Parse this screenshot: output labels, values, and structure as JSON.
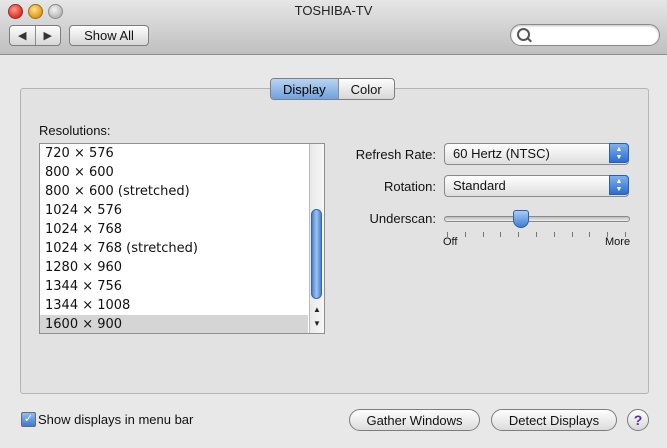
{
  "window": {
    "title": "TOSHIBA-TV"
  },
  "toolbar": {
    "back_glyph": "◀",
    "forward_glyph": "▶",
    "show_all_label": "Show All",
    "search_placeholder": ""
  },
  "tabs": [
    {
      "label": "Display",
      "selected": true
    },
    {
      "label": "Color",
      "selected": false
    }
  ],
  "resolutions": {
    "label": "Resolutions:",
    "items": [
      "720 × 576",
      "800 × 600",
      "800 × 600 (stretched)",
      "1024 × 576",
      "1024 × 768",
      "1024 × 768 (stretched)",
      "1280 × 960",
      "1344 × 756",
      "1344 × 1008",
      "1600 × 900"
    ],
    "selected_index": 9
  },
  "refresh_rate": {
    "label": "Refresh Rate:",
    "value": "60 Hertz (NTSC)"
  },
  "rotation": {
    "label": "Rotation:",
    "value": "Standard"
  },
  "underscan": {
    "label": "Underscan:",
    "min_label": "Off",
    "max_label": "More",
    "value_fraction": 0.41
  },
  "bottom": {
    "show_in_menubar_label": "Show displays in menu bar",
    "show_in_menubar_checked": true,
    "gather_label": "Gather Windows",
    "detect_label": "Detect Displays",
    "help_glyph": "?"
  },
  "icons": [
    "close-icon",
    "minimize-icon",
    "zoom-icon",
    "back-arrow-icon",
    "forward-arrow-icon",
    "search-icon",
    "popup-arrows-icon",
    "checkmark-icon",
    "help-icon"
  ]
}
